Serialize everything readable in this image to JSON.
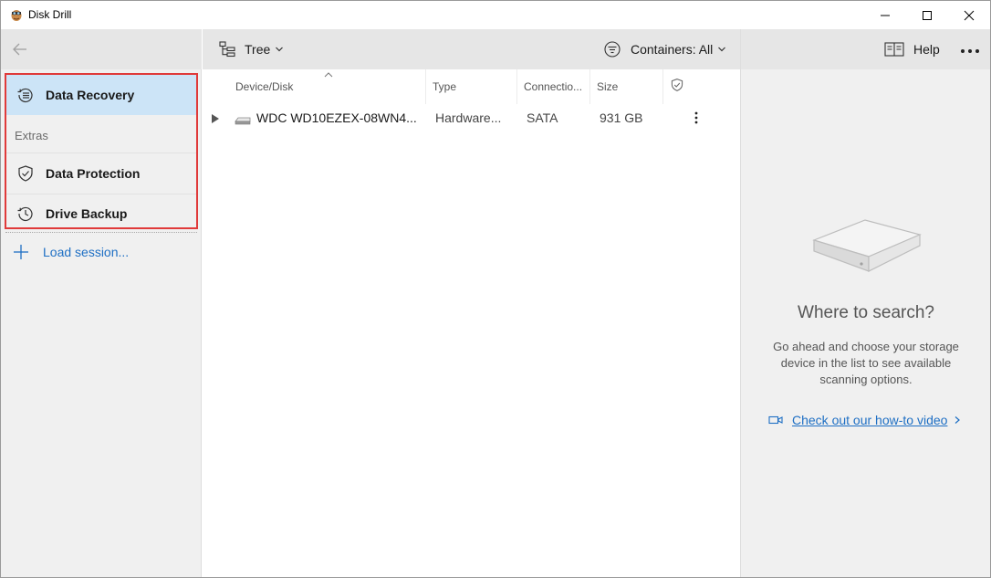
{
  "window": {
    "title": "Disk Drill"
  },
  "sidebar": {
    "items": [
      {
        "label": "Data Recovery",
        "icon": "data-recovery-icon",
        "selected": true
      },
      {
        "label": "Data Protection",
        "icon": "shield-icon"
      },
      {
        "label": "Drive Backup",
        "icon": "backup-clock-icon"
      }
    ],
    "extras_heading": "Extras",
    "load_session": "Load session..."
  },
  "toolbar": {
    "view_label": "Tree",
    "containers_label": "Containers: All"
  },
  "table": {
    "headers": [
      "Device/Disk",
      "Type",
      "Connectio...",
      "Size"
    ],
    "rows": [
      {
        "name": "WDC WD10EZEX-08WN4...",
        "type": "Hardware...",
        "connection": "SATA",
        "size": "931 GB"
      }
    ]
  },
  "right_panel": {
    "help_label": "Help",
    "title": "Where to search?",
    "description": "Go ahead and choose your storage device in the list to see available scanning options.",
    "video_link": "Check out our how-to video"
  },
  "colors": {
    "accent": "#1e6fc4",
    "selection": "#cce4f7",
    "highlight": "#e03a3a"
  }
}
